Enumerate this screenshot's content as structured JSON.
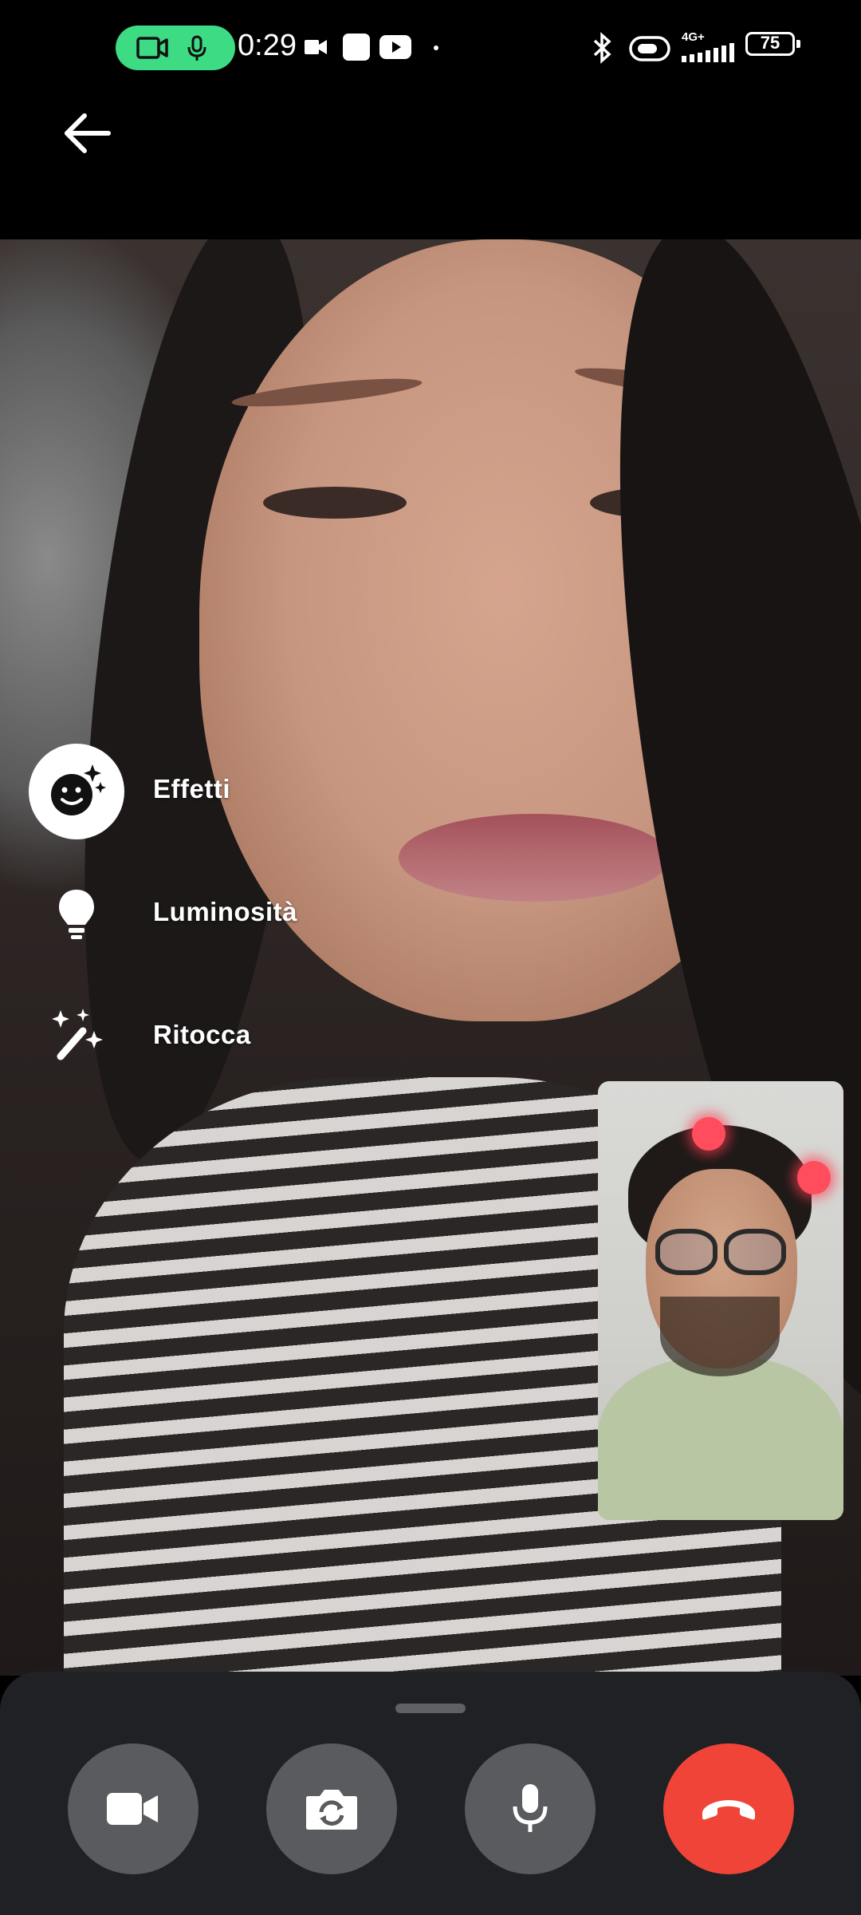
{
  "status_bar": {
    "time": "0:29",
    "network": "4G+",
    "battery": "75",
    "icons": [
      "videocam-icon",
      "mic-icon",
      "video-recording-icon",
      "app-icon",
      "youtube-icon",
      "dot-icon",
      "bluetooth-icon",
      "data-saver-icon",
      "signal-icon",
      "battery-icon"
    ],
    "recording_pill_color": "#3ddc84"
  },
  "header": {
    "back_icon": "arrow-back-icon"
  },
  "effects_menu": {
    "items": [
      {
        "label": "Effetti",
        "icon": "face-sparkle-icon",
        "active": true
      },
      {
        "label": "Luminosità",
        "icon": "lightbulb-icon",
        "active": false
      },
      {
        "label": "Ritocca",
        "icon": "magic-wand-icon",
        "active": false
      }
    ]
  },
  "call_controls": {
    "buttons": [
      {
        "name": "camera",
        "icon": "videocam-icon"
      },
      {
        "name": "flip-camera",
        "icon": "flip-camera-icon"
      },
      {
        "name": "microphone",
        "icon": "mic-icon"
      },
      {
        "name": "end-call",
        "icon": "call-end-icon",
        "color": "#f04438"
      }
    ],
    "button_color": "#5a5b5e",
    "bar_color": "#202124"
  }
}
